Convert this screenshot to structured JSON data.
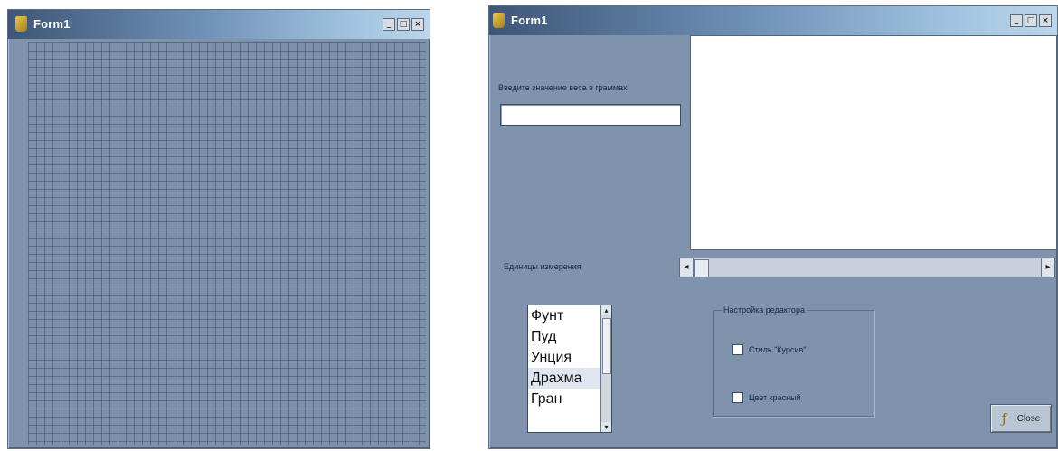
{
  "left_window": {
    "title": "Form1",
    "controls": {
      "minimize": "_",
      "maximize": "□",
      "close": "×"
    }
  },
  "right_window": {
    "title": "Form1",
    "controls": {
      "minimize": "_",
      "maximize": "□",
      "close": "×"
    },
    "prompt_label": "Введите значение веса в граммах",
    "weight_input_value": "",
    "memo_text": "",
    "units_label": "Единицы измерения",
    "scrollbar": {
      "left_arrow": "◂",
      "right_arrow": "▸",
      "position": 0
    },
    "units_list": [
      "Фунт",
      "Пуд",
      "Унция",
      "Драхма",
      "Гран"
    ],
    "units_list_selected": "Драхма",
    "groupbox_caption": "Настройка редактора",
    "checkbox_italic": "Стиль \"Курсив\"",
    "checkbox_red": "Цвет красный",
    "close_button_label": "Close"
  }
}
